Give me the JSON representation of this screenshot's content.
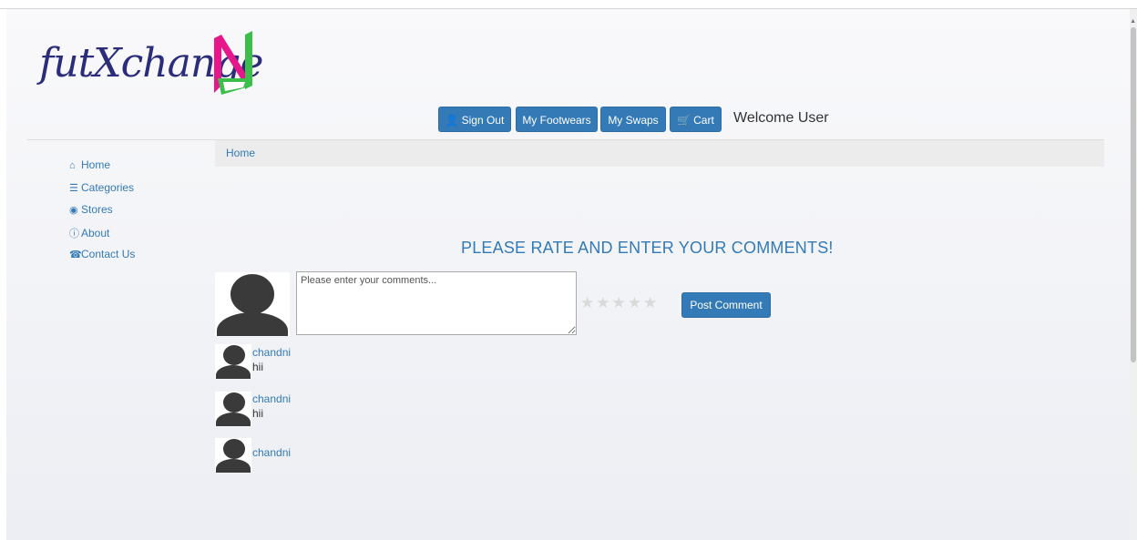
{
  "logo": {
    "text": "futXchange"
  },
  "topnav": {
    "sign_out": "Sign Out",
    "my_footwears": "My Footwears",
    "my_swaps": "My Swaps",
    "cart": "Cart",
    "welcome": "Welcome User"
  },
  "sidebar": {
    "items": [
      {
        "label": "Home",
        "icon": "home-icon"
      },
      {
        "label": "Categories",
        "icon": "list-icon"
      },
      {
        "label": "Stores",
        "icon": "globe-icon"
      },
      {
        "label": "About",
        "icon": "info-icon"
      },
      {
        "label": "Contact Us",
        "icon": "phone-icon"
      }
    ]
  },
  "breadcrumb": {
    "label": "Home"
  },
  "main": {
    "heading": "PLEASE RATE AND ENTER YOUR COMMENTS!",
    "comment_placeholder": "Please enter your comments...",
    "comment_value": "",
    "rating": 0,
    "rating_max": 5,
    "post_label": "Post Comment"
  },
  "comments": [
    {
      "user": "chandni",
      "text": "hii"
    },
    {
      "user": "chandni",
      "text": "hii"
    },
    {
      "user": "chandni",
      "text": ""
    }
  ],
  "colors": {
    "accent": "#337ab7",
    "logo_text": "#2b2d7a",
    "logo_pink": "#e6178a",
    "logo_green": "#3bbf4a"
  }
}
